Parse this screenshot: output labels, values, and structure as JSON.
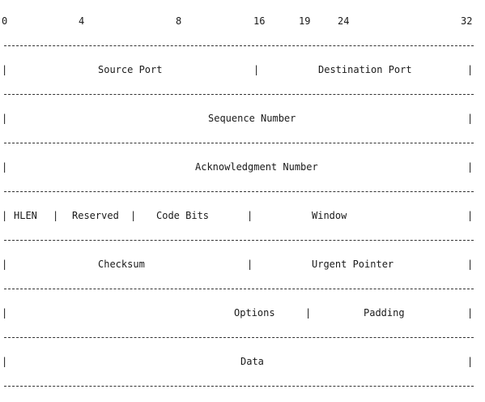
{
  "bit_scale": [
    "0",
    "4",
    "8",
    "16",
    "19",
    "24",
    "32"
  ],
  "separator": "|",
  "rows": [
    {
      "fields": [
        "Source Port",
        "Destination Port"
      ]
    },
    {
      "fields": [
        "Sequence Number"
      ]
    },
    {
      "fields": [
        "Acknowledgment Number"
      ]
    },
    {
      "fields": [
        "HLEN",
        "Reserved",
        "Code Bits",
        "Window"
      ]
    },
    {
      "fields": [
        "Checksum",
        "Urgent Pointer"
      ]
    },
    {
      "fields": [
        "Options",
        "Padding"
      ]
    },
    {
      "fields": [
        "Data"
      ]
    }
  ]
}
